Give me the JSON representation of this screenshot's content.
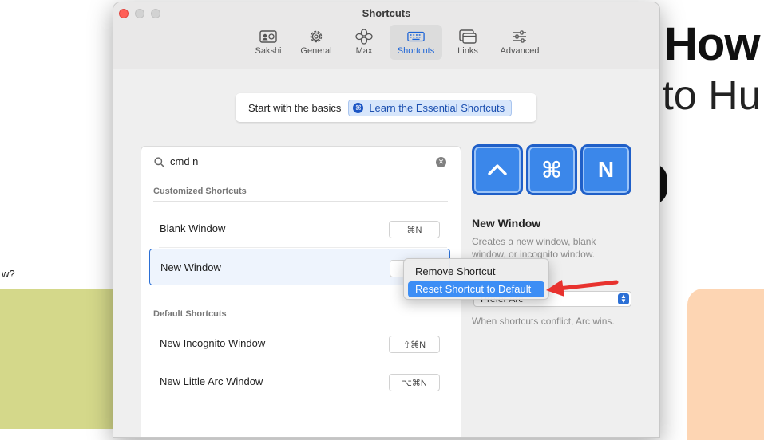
{
  "background": {
    "title": "How",
    "subtitle": "-to Hu",
    "left_text": "w?"
  },
  "window": {
    "title": "Shortcuts",
    "toolbar": [
      {
        "label": "Sakshi",
        "icon": "profile-card-icon"
      },
      {
        "label": "General",
        "icon": "gear-icon"
      },
      {
        "label": "Max",
        "icon": "max-flower-icon"
      },
      {
        "label": "Shortcuts",
        "icon": "keyboard-icon",
        "active": true
      },
      {
        "label": "Links",
        "icon": "links-window-icon"
      },
      {
        "label": "Advanced",
        "icon": "sliders-icon"
      }
    ]
  },
  "basics": {
    "text": "Start with the basics",
    "button_label": "Learn the Essential Shortcuts",
    "button_icon": "⌘"
  },
  "search": {
    "value": "cmd n",
    "placeholder": "Search"
  },
  "sections": {
    "customized": {
      "header": "Customized Shortcuts",
      "rows": [
        {
          "label": "Blank Window",
          "shortcut": "⌘N"
        },
        {
          "label": "New Window",
          "shortcut": "",
          "selected": true
        }
      ]
    },
    "default": {
      "header": "Default Shortcuts",
      "rows": [
        {
          "label": "New Incognito Window",
          "shortcut": "⇧⌘N"
        },
        {
          "label": "New Little Arc Window",
          "shortcut": "⌥⌘N"
        }
      ]
    }
  },
  "detail": {
    "keys": [
      "^",
      "⌘",
      "N"
    ],
    "title": "New Window",
    "description": "Creates a new window, blank window, or incognito window.",
    "conflict_value": "Prefer Arc",
    "conflict_note": "When shortcuts conflict, Arc wins."
  },
  "context_menu": {
    "items": [
      {
        "label": "Remove Shortcut"
      },
      {
        "label": "Reset Shortcut to Default",
        "highlighted": true
      }
    ]
  },
  "colors": {
    "accent": "#2b6fd5",
    "keycap": "#3b87ea",
    "highlight": "#3d8ef5",
    "annotation_arrow": "#e8322e"
  }
}
